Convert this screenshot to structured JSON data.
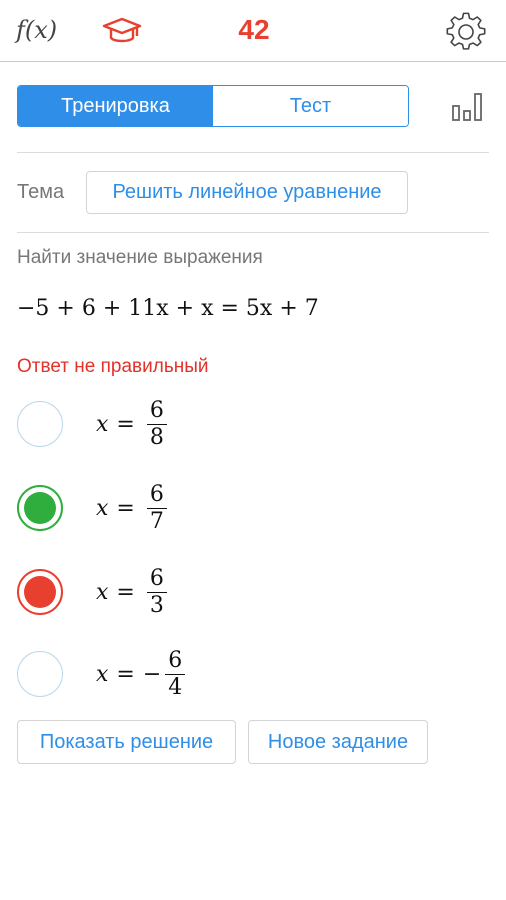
{
  "header": {
    "logo_text": "f(x)",
    "cap_icon": "graduation-cap-icon",
    "score": "42",
    "settings_icon": "gear-icon"
  },
  "mode_tabs": [
    {
      "label": "Тренировка",
      "active": true
    },
    {
      "label": "Тест",
      "active": false
    }
  ],
  "stats_icon": "bar-chart-icon",
  "topic": {
    "label": "Тема",
    "value": "Решить линейное уравнение"
  },
  "task": {
    "prompt": "Найти значение выражения",
    "equation": "−5 + 6 + 11x + x = 5x + 7"
  },
  "feedback": "Ответ не правильный",
  "options": [
    {
      "variable": "x",
      "sign": "",
      "numerator": "6",
      "denominator": "8",
      "state": "empty"
    },
    {
      "variable": "x",
      "sign": "",
      "numerator": "6",
      "denominator": "7",
      "state": "correct"
    },
    {
      "variable": "x",
      "sign": "",
      "numerator": "6",
      "denominator": "3",
      "state": "wrong"
    },
    {
      "variable": "x",
      "sign": "−",
      "numerator": "6",
      "denominator": "4",
      "state": "empty"
    }
  ],
  "actions": {
    "show_solution": "Показать решение",
    "new_task": "Новое задание"
  },
  "colors": {
    "accent": "#2f8ee8",
    "correct": "#2fae3e",
    "wrong": "#e8402f",
    "score": "#e8402f"
  }
}
